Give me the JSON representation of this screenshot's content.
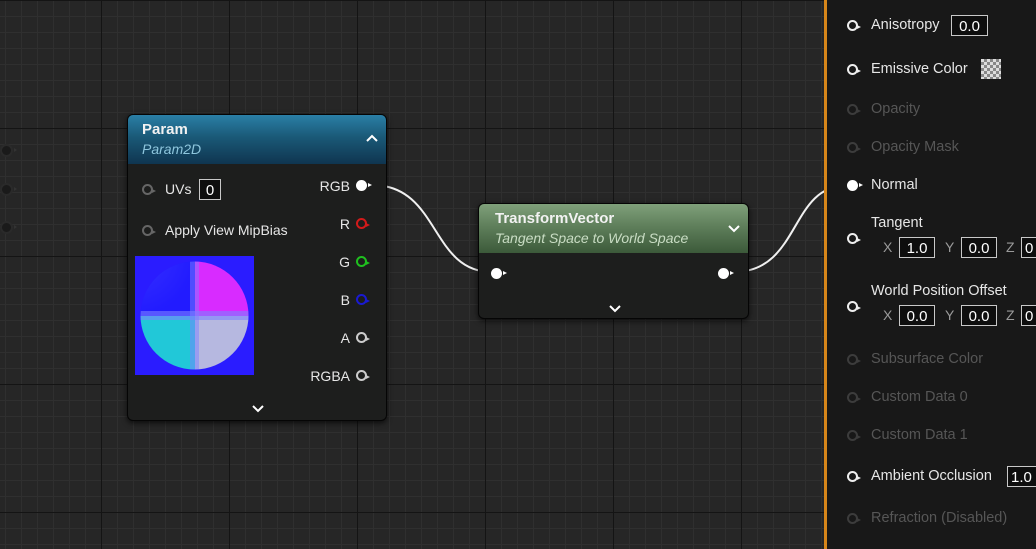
{
  "param_node": {
    "title": "Param",
    "subtitle": "Param2D",
    "inputs": [
      {
        "label": "UVs",
        "value": "0"
      },
      {
        "label": "Apply View MipBias"
      }
    ],
    "outputs": [
      {
        "label": "RGB",
        "color": "#ffffff"
      },
      {
        "label": "R",
        "color": "#d21a1a"
      },
      {
        "label": "G",
        "color": "#1fc01f"
      },
      {
        "label": "B",
        "color": "#1a1ad2"
      },
      {
        "label": "A",
        "color": "#cccccc"
      },
      {
        "label": "RGBA",
        "color": "#cccccc"
      }
    ],
    "header_color": "#1e6a8c"
  },
  "transform_node": {
    "title": "TransformVector",
    "subtitle": "Tangent Space to World Space",
    "header_color": "#5f7f5b"
  },
  "material_panel": {
    "accent": "#d7861a",
    "rows": [
      {
        "label": "Anisotropy",
        "value": "0.0",
        "enabled": true
      },
      {
        "label": "Emissive Color",
        "enabled": true
      },
      {
        "label": "Opacity",
        "enabled": false
      },
      {
        "label": "Opacity Mask",
        "enabled": false
      },
      {
        "label": "Normal",
        "enabled": true,
        "connected": true
      },
      {
        "label": "Tangent",
        "enabled": true,
        "x": "1.0",
        "y": "0.0",
        "z": "0"
      },
      {
        "label": "World Position Offset",
        "enabled": true,
        "x": "0.0",
        "y": "0.0",
        "z": "0"
      },
      {
        "label": "Subsurface Color",
        "enabled": false
      },
      {
        "label": "Custom Data 0",
        "enabled": false
      },
      {
        "label": "Custom Data 1",
        "enabled": false
      },
      {
        "label": "Ambient Occlusion",
        "value": "1.0",
        "enabled": true
      },
      {
        "label": "Refraction (Disabled)",
        "enabled": false
      }
    ],
    "axis_labels": [
      "X",
      "Y",
      "Z"
    ]
  }
}
